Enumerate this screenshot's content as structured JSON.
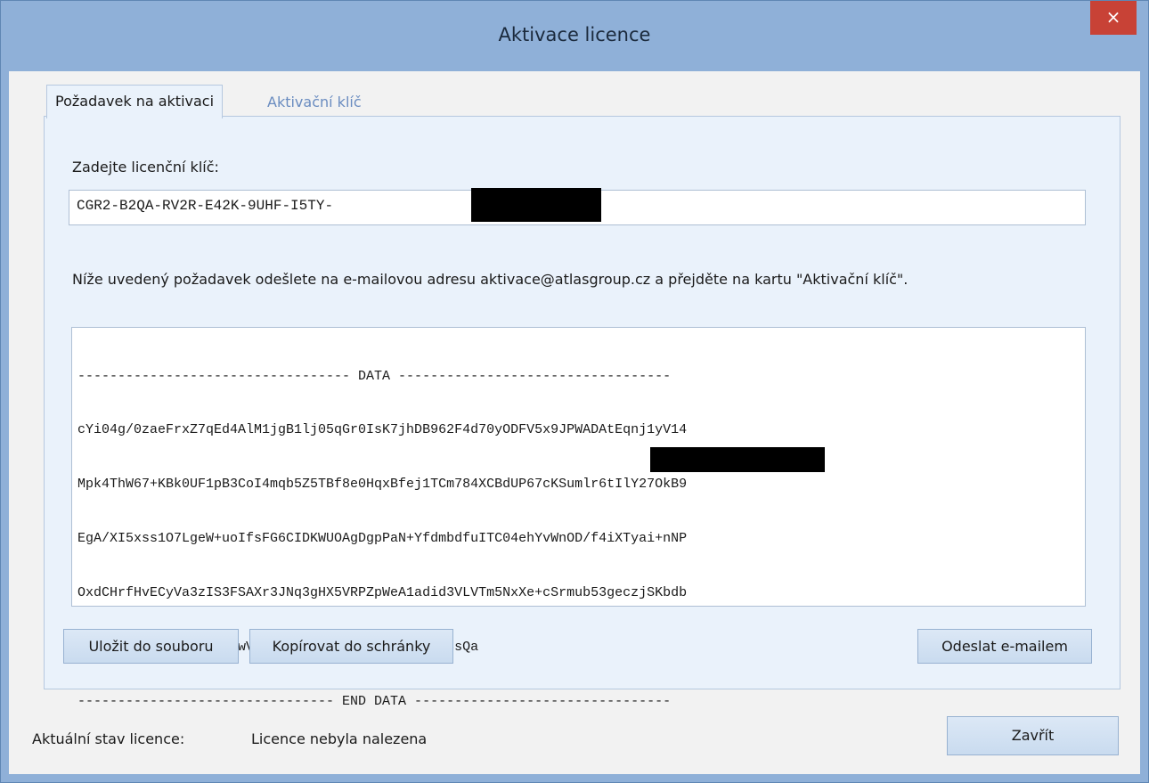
{
  "window": {
    "title": "Aktivace licence",
    "close_icon": "×"
  },
  "tabs": [
    {
      "label": "Požadavek na aktivaci",
      "active": true
    },
    {
      "label": "Aktivační klíč",
      "active": false
    }
  ],
  "license_key": {
    "label": "Zadejte licenční klíč:",
    "value": "CGR2-B2QA-RV2R-E42K-9UHF-I5TY-"
  },
  "instruction": "Níže uvedený požadavek odešlete na e-mailovou adresu aktivace@atlasgroup.cz a přejděte na kartu \"Aktivační klíč\".",
  "request_data": {
    "lines": [
      "---------------------------------- DATA ----------------------------------",
      "cYi04g/0zaeFrxZ7qEd4AlM1jgB1lj05qGr0IsK7jhDB962F4d70yODFV5x9JPWADAtEqnj1yV14",
      "Mpk4ThW67+KBk0UF1pB3CoI4mqb5Z5TBf8e0HqxBfej1TCm784XCBdUP67cKSumlr6tIlY27OkB9",
      "EgA/XI5xss1O7LgeW+uoIfsFG6CIDKWUOAgDgpPaN+YfdmbdfuITC04ehYvWnOD/f4iXTyai+nNP",
      "OxdCHrfHvECyVa3zIS3FSAXr3JNq3gHX5VRPZpWeA1adid3VLVTm5NxXe+cSrmub53geczjSKbdb",
      "3NguwRTmcNjweJ2ChGI/wVTs1oW6VIFoPObBVGRRPwNmg98sQa",
      "-------------------------------- END DATA --------------------------------"
    ]
  },
  "buttons": {
    "save": "Uložit do souboru",
    "copy": "Kopírovat do schránky",
    "email": "Odeslat e-mailem",
    "close": "Zavřít"
  },
  "status": {
    "label": "Aktuální stav licence:",
    "value": "Licence nebyla nalezena"
  }
}
